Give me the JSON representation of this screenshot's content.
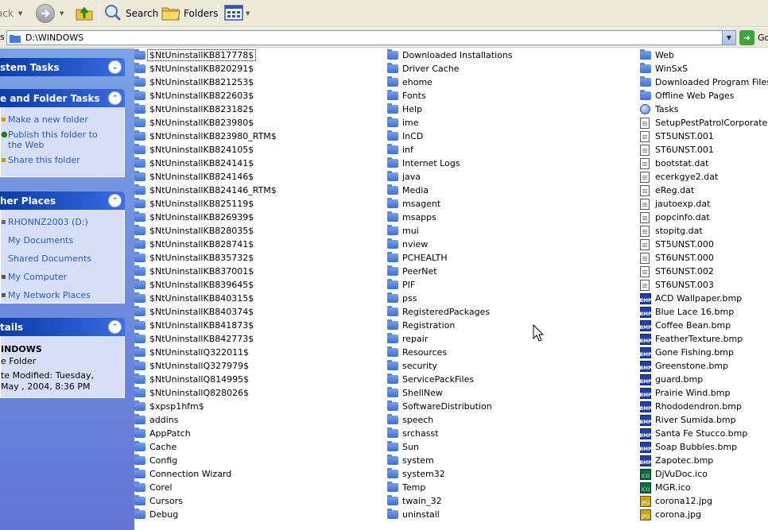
{
  "toolbar": {
    "back_label": "ack",
    "search_label": "Search",
    "folders_label": "Folders"
  },
  "address": {
    "label": "s",
    "path": "D:\\WINDOWS",
    "go_label": "Go"
  },
  "taskpane": {
    "system_tasks": {
      "title": "stem Tasks"
    },
    "file_folder_tasks": {
      "title": "e and Folder Tasks",
      "links": [
        {
          "label": "Make a new folder",
          "icon": "new-folder-icon"
        },
        {
          "label": "Publish this folder to the Web",
          "icon": "publish-web-icon"
        },
        {
          "label": "Share this folder",
          "icon": "share-icon"
        }
      ]
    },
    "other_places": {
      "title": "her Places",
      "links": [
        {
          "label": "RHONNZ2003 (D:)",
          "icon": "drive-icon"
        },
        {
          "label": "My Documents",
          "icon": "my-documents-icon"
        },
        {
          "label": "Shared Documents",
          "icon": "shared-documents-icon"
        },
        {
          "label": "My Computer",
          "icon": "my-computer-icon"
        },
        {
          "label": "My Network Places",
          "icon": "network-places-icon"
        }
      ]
    },
    "details": {
      "title": "tails",
      "name": "INDOWS",
      "type": "e Folder",
      "modified": "te Modified: Tuesday, May , 2004, 8:36 PM"
    }
  },
  "files": {
    "column1": [
      {
        "name": "$NtUninstallKB817778$",
        "type": "folder"
      },
      {
        "name": "$NtUninstallKB820291$",
        "type": "folder"
      },
      {
        "name": "$NtUninstallKB821253$",
        "type": "folder"
      },
      {
        "name": "$NtUninstallKB822603$",
        "type": "folder"
      },
      {
        "name": "$NtUninstallKB823182$",
        "type": "folder"
      },
      {
        "name": "$NtUninstallKB823980$",
        "type": "folder"
      },
      {
        "name": "$NtUninstallKB823980_RTM$",
        "type": "folder"
      },
      {
        "name": "$NtUninstallKB824105$",
        "type": "folder"
      },
      {
        "name": "$NtUninstallKB824141$",
        "type": "folder"
      },
      {
        "name": "$NtUninstallKB824146$",
        "type": "folder"
      },
      {
        "name": "$NtUninstallKB824146_RTM$",
        "type": "folder"
      },
      {
        "name": "$NtUninstallKB825119$",
        "type": "folder"
      },
      {
        "name": "$NtUninstallKB826939$",
        "type": "folder"
      },
      {
        "name": "$NtUninstallKB828035$",
        "type": "folder"
      },
      {
        "name": "$NtUninstallKB828741$",
        "type": "folder"
      },
      {
        "name": "$NtUninstallKB835732$",
        "type": "folder"
      },
      {
        "name": "$NtUninstallKB837001$",
        "type": "folder"
      },
      {
        "name": "$NtUninstallKB839645$",
        "type": "folder"
      },
      {
        "name": "$NtUninstallKB840315$",
        "type": "folder"
      },
      {
        "name": "$NtUninstallKB840374$",
        "type": "folder"
      },
      {
        "name": "$NtUninstallKB841873$",
        "type": "folder"
      },
      {
        "name": "$NtUninstallKB842773$",
        "type": "folder"
      },
      {
        "name": "$NtUninstallQ322011$",
        "type": "folder"
      },
      {
        "name": "$NtUninstallQ327979$",
        "type": "folder"
      },
      {
        "name": "$NtUninstallQ814995$",
        "type": "folder"
      },
      {
        "name": "$NtUninstallQ828026$",
        "type": "folder"
      },
      {
        "name": "$xpsp1hfm$",
        "type": "folder"
      },
      {
        "name": "addins",
        "type": "folder"
      },
      {
        "name": "AppPatch",
        "type": "folder"
      },
      {
        "name": "Cache",
        "type": "folder"
      },
      {
        "name": "Config",
        "type": "folder"
      },
      {
        "name": "Connection Wizard",
        "type": "folder"
      },
      {
        "name": "Corel",
        "type": "folder"
      },
      {
        "name": "Cursors",
        "type": "folder"
      },
      {
        "name": "Debug",
        "type": "folder"
      }
    ],
    "column2": [
      {
        "name": "Downloaded Installations",
        "type": "folder"
      },
      {
        "name": "Driver Cache",
        "type": "folder"
      },
      {
        "name": "ehome",
        "type": "folder"
      },
      {
        "name": "Fonts",
        "type": "folder"
      },
      {
        "name": "Help",
        "type": "folder"
      },
      {
        "name": "ime",
        "type": "folder"
      },
      {
        "name": "InCD",
        "type": "folder"
      },
      {
        "name": "inf",
        "type": "folder"
      },
      {
        "name": "Internet Logs",
        "type": "folder"
      },
      {
        "name": "java",
        "type": "folder"
      },
      {
        "name": "Media",
        "type": "folder"
      },
      {
        "name": "msagent",
        "type": "folder"
      },
      {
        "name": "msapps",
        "type": "folder"
      },
      {
        "name": "mui",
        "type": "folder"
      },
      {
        "name": "nview",
        "type": "folder"
      },
      {
        "name": "PCHEALTH",
        "type": "folder"
      },
      {
        "name": "PeerNet",
        "type": "folder"
      },
      {
        "name": "PIF",
        "type": "folder"
      },
      {
        "name": "pss",
        "type": "folder"
      },
      {
        "name": "RegisteredPackages",
        "type": "folder"
      },
      {
        "name": "Registration",
        "type": "folder"
      },
      {
        "name": "repair",
        "type": "folder"
      },
      {
        "name": "Resources",
        "type": "folder"
      },
      {
        "name": "security",
        "type": "folder"
      },
      {
        "name": "ServicePackFiles",
        "type": "folder"
      },
      {
        "name": "ShellNew",
        "type": "folder"
      },
      {
        "name": "SoftwareDistribution",
        "type": "folder"
      },
      {
        "name": "speech",
        "type": "folder"
      },
      {
        "name": "srchasst",
        "type": "folder"
      },
      {
        "name": "Sun",
        "type": "folder"
      },
      {
        "name": "system",
        "type": "folder"
      },
      {
        "name": "system32",
        "type": "folder"
      },
      {
        "name": "Temp",
        "type": "folder"
      },
      {
        "name": "twain_32",
        "type": "folder"
      },
      {
        "name": "uninstall",
        "type": "folder"
      }
    ],
    "column3": [
      {
        "name": "Web",
        "type": "folder"
      },
      {
        "name": "WinSxS",
        "type": "folder"
      },
      {
        "name": "Downloaded Program Files",
        "type": "folder"
      },
      {
        "name": "Offline Web Pages",
        "type": "folder"
      },
      {
        "name": "Tasks",
        "type": "tasks"
      },
      {
        "name": "SetupPestPatrolCorporate.mif",
        "type": "file"
      },
      {
        "name": "ST5UNST.001",
        "type": "file"
      },
      {
        "name": "ST6UNST.001",
        "type": "file"
      },
      {
        "name": "bootstat.dat",
        "type": "file"
      },
      {
        "name": "ecerkgye2.dat",
        "type": "file"
      },
      {
        "name": "eReg.dat",
        "type": "file"
      },
      {
        "name": "jautoexp.dat",
        "type": "file"
      },
      {
        "name": "popcinfo.dat",
        "type": "file"
      },
      {
        "name": "stopitg.dat",
        "type": "file"
      },
      {
        "name": "ST5UNST.000",
        "type": "file"
      },
      {
        "name": "ST6UNST.000",
        "type": "file"
      },
      {
        "name": "ST6UNST.002",
        "type": "file"
      },
      {
        "name": "ST6UNST.003",
        "type": "file"
      },
      {
        "name": "ACD Wallpaper.bmp",
        "type": "bmp"
      },
      {
        "name": "Blue Lace 16.bmp",
        "type": "bmp"
      },
      {
        "name": "Coffee Bean.bmp",
        "type": "bmp"
      },
      {
        "name": "FeatherTexture.bmp",
        "type": "bmp"
      },
      {
        "name": "Gone Fishing.bmp",
        "type": "bmp"
      },
      {
        "name": "Greenstone.bmp",
        "type": "bmp"
      },
      {
        "name": "guard.bmp",
        "type": "bmp"
      },
      {
        "name": "Prairie Wind.bmp",
        "type": "bmp"
      },
      {
        "name": "Rhododendron.bmp",
        "type": "bmp"
      },
      {
        "name": "River Sumida.bmp",
        "type": "bmp"
      },
      {
        "name": "Santa Fe Stucco.bmp",
        "type": "bmp"
      },
      {
        "name": "Soap Bubbles.bmp",
        "type": "bmp"
      },
      {
        "name": "Zapotec.bmp",
        "type": "bmp"
      },
      {
        "name": "DjVuDoc.ico",
        "type": "ico"
      },
      {
        "name": "MGR.ico",
        "type": "ico"
      },
      {
        "name": "corona12.jpg",
        "type": "jpg"
      },
      {
        "name": "corona.jpg",
        "type": "jpg"
      }
    ]
  }
}
